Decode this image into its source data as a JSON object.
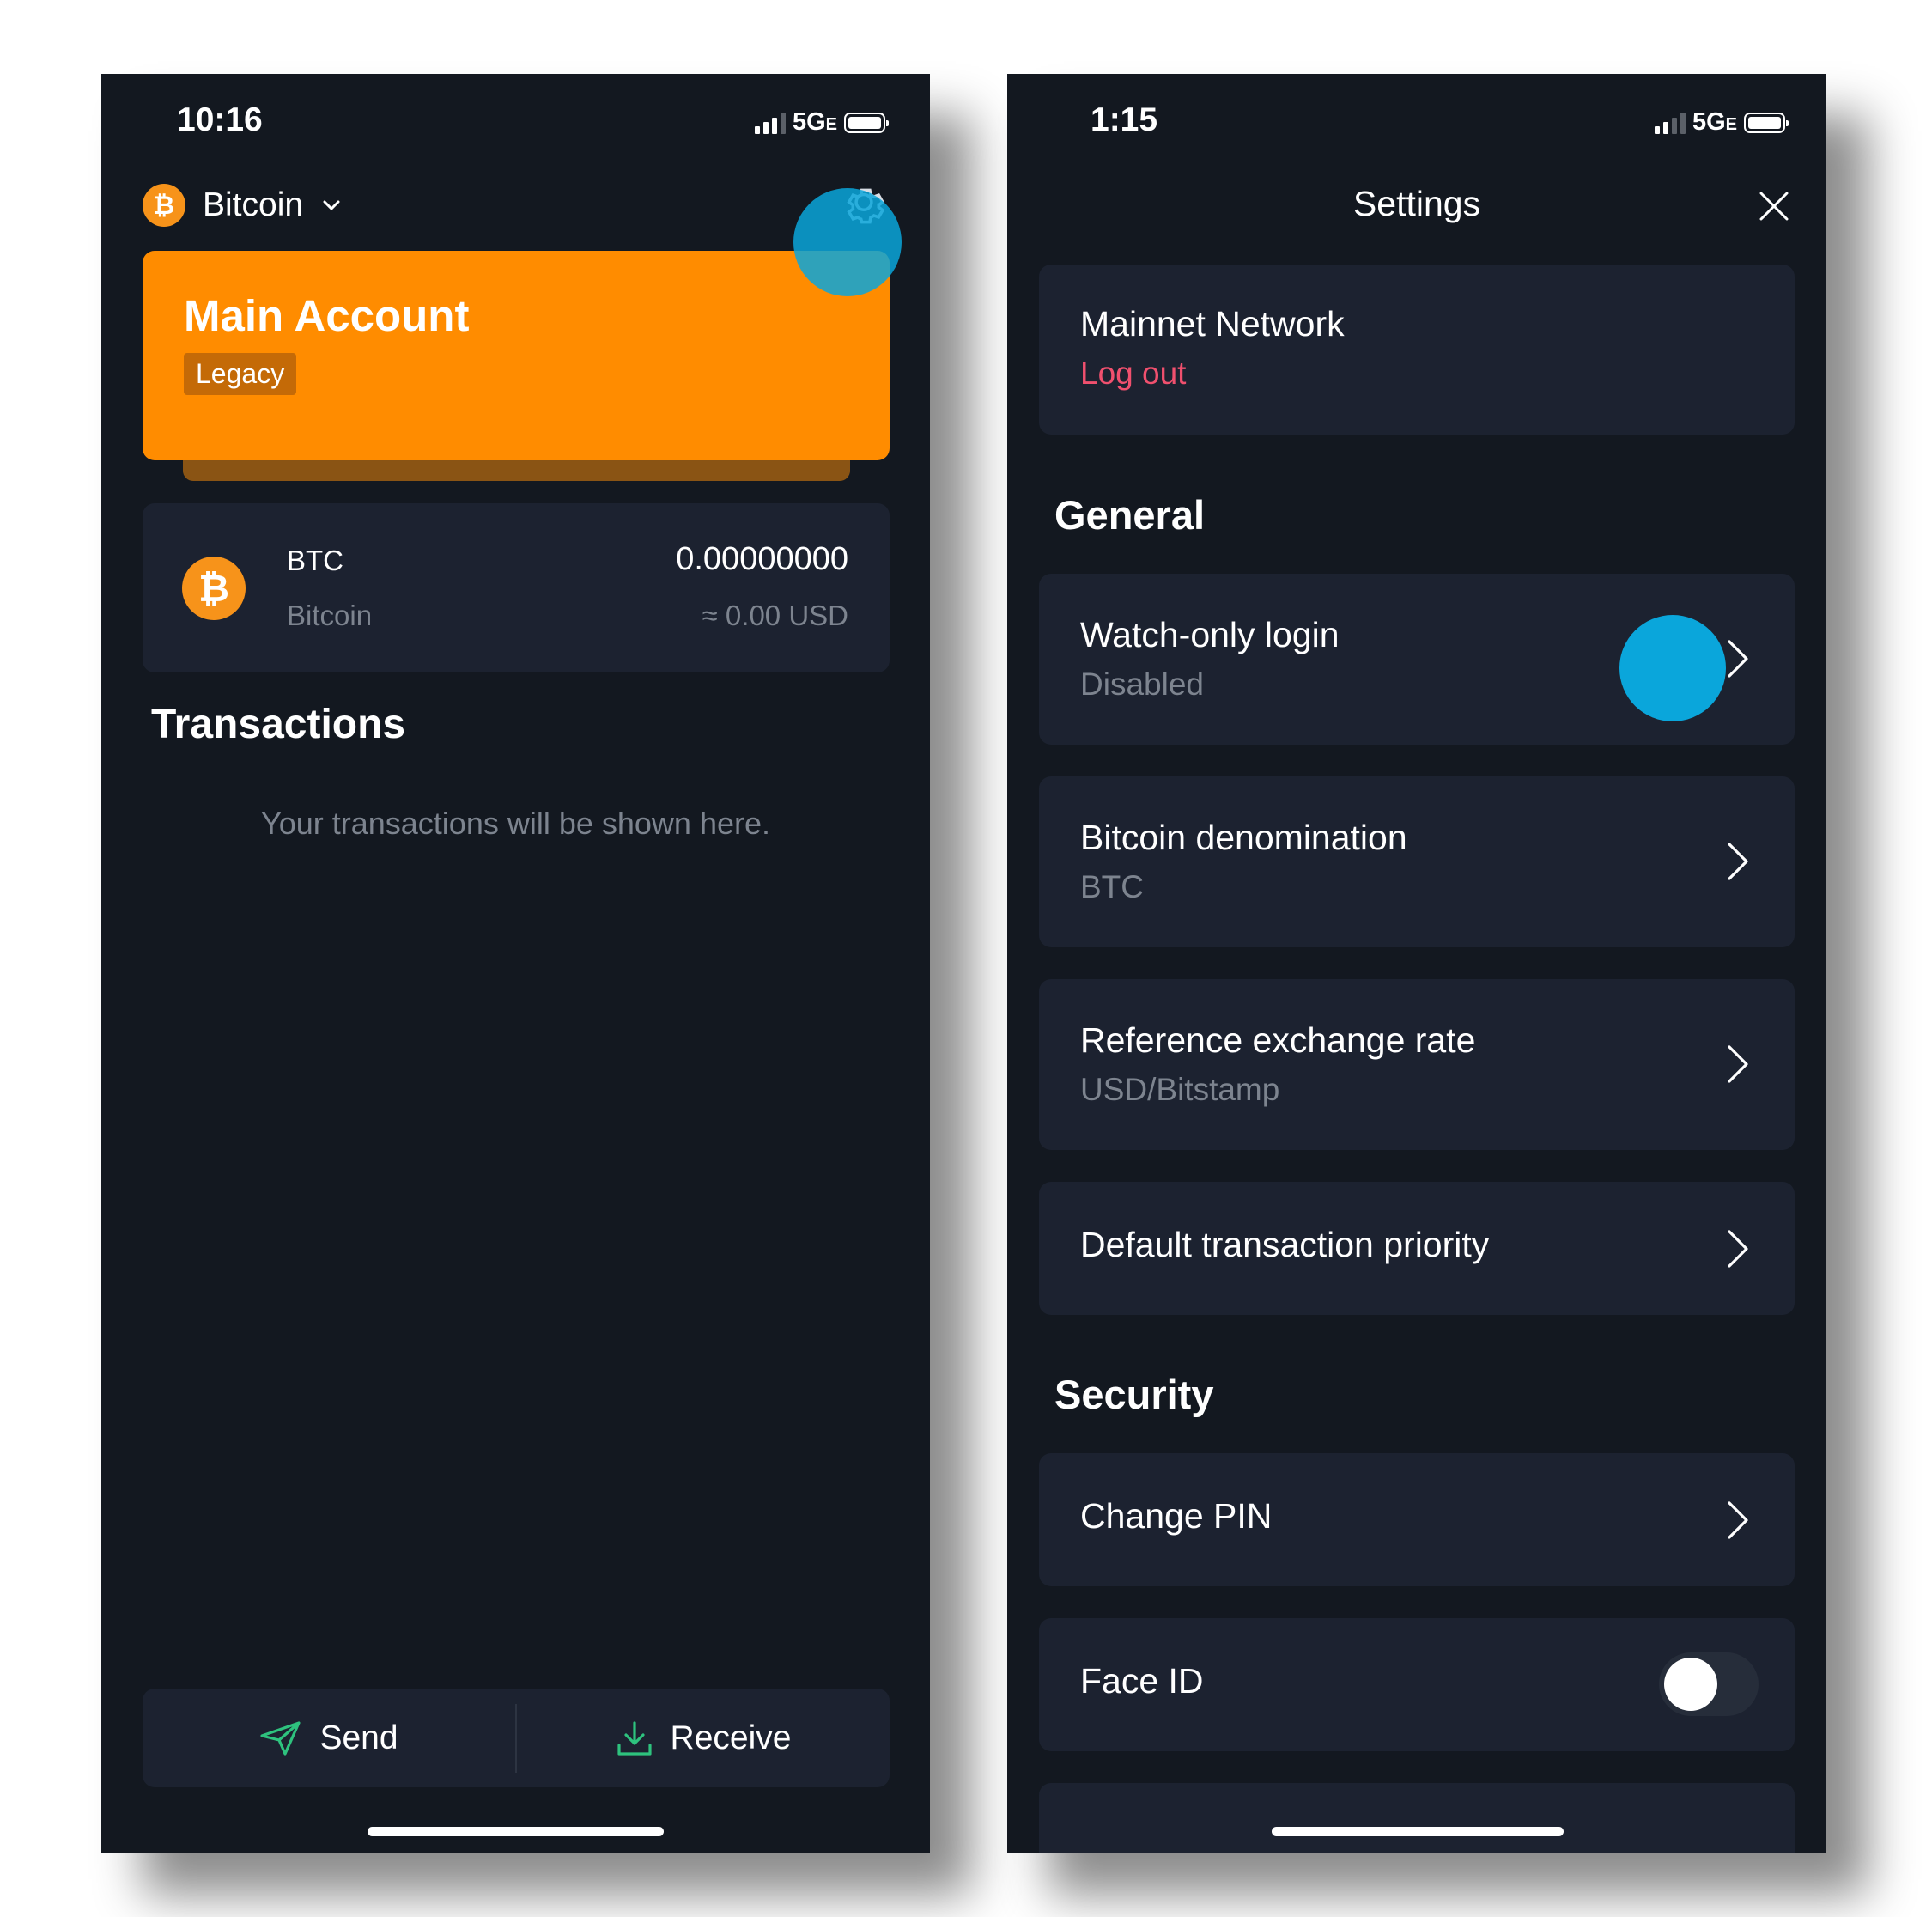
{
  "wallet_screen": {
    "status": {
      "time": "10:16",
      "network": "5G",
      "network_suffix": "E"
    },
    "coin_selector": {
      "name": "Bitcoin",
      "icon": "bitcoin-icon"
    },
    "settings_icon": "gear-icon",
    "account_card": {
      "title": "Main Account",
      "badge": "Legacy",
      "color": "#ff8c00"
    },
    "asset": {
      "symbol": "BTC",
      "name": "Bitcoin",
      "balance": "0.00000000",
      "fiat": "≈ 0.00 USD"
    },
    "transactions": {
      "title": "Transactions",
      "empty_text": "Your transactions will be shown here."
    },
    "actions": {
      "send": "Send",
      "receive": "Receive",
      "accent": "#2ec27e"
    }
  },
  "settings_screen": {
    "status": {
      "time": "1:15",
      "network": "5G",
      "network_suffix": "E"
    },
    "header": {
      "title": "Settings",
      "close_icon": "close-icon"
    },
    "network_card": {
      "title": "Mainnet Network",
      "logout": "Log out",
      "logout_color": "#f0506e"
    },
    "general": {
      "title": "General",
      "items": [
        {
          "title": "Watch-only login",
          "subtitle": "Disabled"
        },
        {
          "title": "Bitcoin denomination",
          "subtitle": "BTC"
        },
        {
          "title": "Reference exchange rate",
          "subtitle": "USD/Bitstamp"
        },
        {
          "title": "Default transaction priority"
        }
      ]
    },
    "security": {
      "title": "Security",
      "items": [
        {
          "title": "Change PIN"
        },
        {
          "title": "Face ID",
          "toggle": "off"
        }
      ]
    }
  }
}
